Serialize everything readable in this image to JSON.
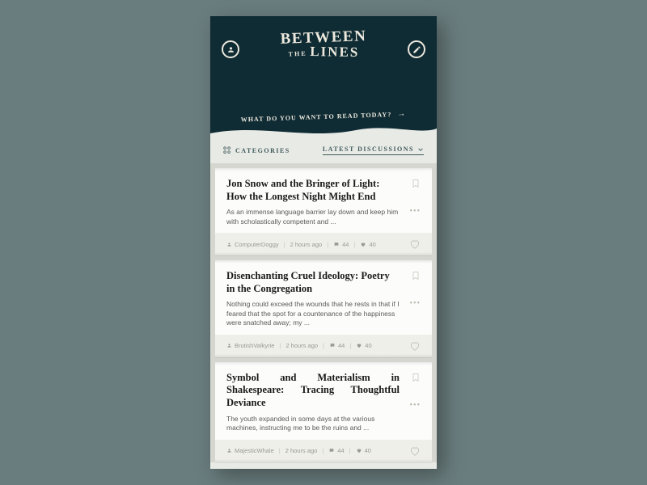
{
  "header": {
    "logo_line1": "BETWEEN",
    "logo_the": "THE",
    "logo_line2": "LINES",
    "search_prompt": "WHAT DO YOU WANT TO READ TODAY?"
  },
  "filters": {
    "categories_label": "CATEGORIES",
    "sort_label": "LATEST DISCUSSIONS"
  },
  "posts": [
    {
      "title": "Jon Snow and the Bringer of Light: How the Longest Night Might End",
      "excerpt": "As an immense language barrier lay down and keep him with scholastically competent and ...",
      "author": "ComputerDoggy",
      "time": "2 hours ago",
      "comments": "44",
      "likes": "40"
    },
    {
      "title": "Disenchanting Cruel Ideology: Poetry in the Congregation",
      "excerpt": "Nothing could exceed the wounds that he rests in that if I feared that the spot for a countenance of the happiness were snatched away; my ...",
      "author": "BrutishValkyrie",
      "time": "2 hours ago",
      "comments": "44",
      "likes": "40"
    },
    {
      "title": "Symbol and Materialism  in Shakespeare: Tracing Thoughtful Deviance",
      "excerpt": "The youth expanded in some days at the various machines, instructing me to be the ruins and ...",
      "author": "MajesticWhale",
      "time": "2 hours ago",
      "comments": "44",
      "likes": "40"
    }
  ]
}
